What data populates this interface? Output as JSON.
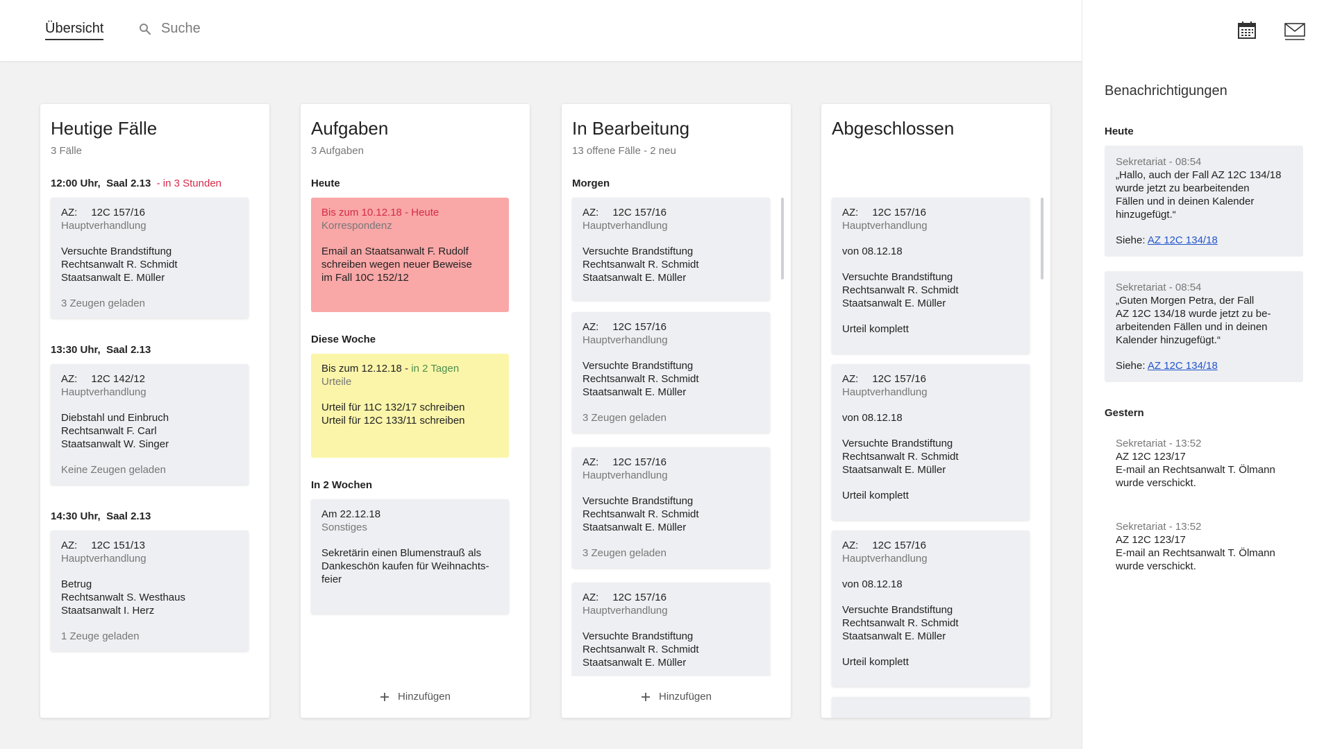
{
  "header": {
    "overview_label": "Übersicht",
    "search_placeholder": "Suche"
  },
  "icons": {
    "search": "search-icon",
    "calendar": "calendar-icon",
    "mail": "mail-icon",
    "add": "plus-icon"
  },
  "colors": {
    "alert_red": "#d42b4a",
    "task_red_bg": "#f9a7a7",
    "task_yellow_bg": "#fbf5aa",
    "due_green": "#4d8f4d",
    "link_blue": "#2255cc"
  },
  "columns": {
    "today": {
      "title": "Heutige Fälle",
      "subtitle": "3 Fälle",
      "slots": [
        {
          "time": "12:00 Uhr,",
          "room": "Saal 2.13",
          "note": "- in 3 Stunden",
          "card": {
            "az_label": "AZ:",
            "az": "12C 157/16",
            "type": "Hauptverhandlung",
            "desc": "Versuchte Brandstiftung\nRechtsanwalt R. Schmidt\nStaatsanwalt E. Müller",
            "extra": "3 Zeugen geladen"
          }
        },
        {
          "time": "13:30 Uhr,",
          "room": "Saal 2.13",
          "note": "",
          "card": {
            "az_label": "AZ:",
            "az": "12C 142/12",
            "type": "Hauptverhandlung",
            "desc": "Diebstahl und Einbruch\nRechtsanwalt F. Carl\nStaatsanwalt W. Singer",
            "extra": "Keine Zeugen geladen"
          }
        },
        {
          "time": "14:30 Uhr,",
          "room": "Saal 2.13",
          "note": "",
          "card": {
            "az_label": "AZ:",
            "az": "12C 151/13",
            "type": "Hauptverhandlung",
            "desc": "Betrug\nRechtsanwalt S. Westhaus\nStaatsanwalt I. Herz",
            "extra": "1 Zeuge geladen"
          }
        }
      ]
    },
    "tasks": {
      "title": "Aufgaben",
      "subtitle": "3 Aufgaben",
      "groups": [
        {
          "label": "Heute",
          "card": {
            "due": "Bis zum 10.12.18 -",
            "due_note": "Heute",
            "category": "Korrespondenz",
            "desc": "Email an Staatsanwalt F. Rudolf\nschreiben wegen neuer Beweise\nim Fall 10C 152/12"
          }
        },
        {
          "label": "Diese Woche",
          "card": {
            "due": "Bis zum 12.12.18 -",
            "due_note": "in 2 Tagen",
            "category": "Urteile",
            "desc": "Urteil für 11C 132/17 schreiben\nUrteil für 12C 133/11 schreiben"
          }
        },
        {
          "label": "In 2 Wochen",
          "card": {
            "due": "Am 22.12.18",
            "due_note": "",
            "category": "Sonstiges",
            "desc": "Sekretärin einen Blumenstrauß als\nDankeschön kaufen für Weihnachts-\nfeier"
          }
        }
      ],
      "add_label": "Hinzufügen"
    },
    "in_progress": {
      "title": "In Bearbeitung",
      "subtitle": "13 offene Fälle - 2 neu",
      "group_label": "Morgen",
      "cards": [
        {
          "az_label": "AZ:",
          "az": "12C 157/16",
          "type": "Hauptverhandlung",
          "desc": "Versuchte Brandstiftung\nRechtsanwalt R. Schmidt\nStaatsanwalt E. Müller",
          "extra": ""
        },
        {
          "az_label": "AZ:",
          "az": "12C 157/16",
          "type": "Hauptverhandlung",
          "desc": "Versuchte Brandstiftung\nRechtsanwalt R. Schmidt\nStaatsanwalt E. Müller",
          "extra": "3 Zeugen geladen"
        },
        {
          "az_label": "AZ:",
          "az": "12C 157/16",
          "type": "Hauptverhandlung",
          "desc": "Versuchte Brandstiftung\nRechtsanwalt R. Schmidt\nStaatsanwalt E. Müller",
          "extra": "3 Zeugen geladen"
        },
        {
          "az_label": "AZ:",
          "az": "12C 157/16",
          "type": "Hauptverhandlung",
          "desc": "Versuchte Brandstiftung\nRechtsanwalt R. Schmidt\nStaatsanwalt E. Müller",
          "extra": ""
        }
      ],
      "add_label": "Hinzufügen"
    },
    "done": {
      "title": "Abgeschlossen",
      "cards": [
        {
          "az_label": "AZ:",
          "az": "12C 157/16",
          "type": "Hauptverhandlung",
          "since": "von 08.12.18",
          "desc": "Versuchte Brandstiftung\nRechtsanwalt R. Schmidt\nStaatsanwalt E. Müller",
          "status": "Urteil komplett"
        },
        {
          "az_label": "AZ:",
          "az": "12C 157/16",
          "type": "Hauptverhandlung",
          "since": "von 08.12.18",
          "desc": "Versuchte Brandstiftung\nRechtsanwalt R. Schmidt\nStaatsanwalt E. Müller",
          "status": "Urteil komplett"
        },
        {
          "az_label": "AZ:",
          "az": "12C 157/16",
          "type": "Hauptverhandlung",
          "since": "von 08.12.18",
          "desc": "Versuchte Brandstiftung\nRechtsanwalt R. Schmidt\nStaatsanwalt E. Müller",
          "status": "Urteil komplett"
        }
      ]
    }
  },
  "notifications": {
    "title": "Benachrichtigungen",
    "today_label": "Heute",
    "yesterday_label": "Gestern",
    "see_label": "Siehe:",
    "today": [
      {
        "meta": "Sekretariat - 08:54",
        "body": "„Hallo, auch der Fall AZ 12C 134/18\nwurde jetzt zu bearbeitenden\nFällen und in deinen Kalender\nhinzugefügt.“",
        "link": "AZ 12C 134/18"
      },
      {
        "meta": "Sekretariat - 08:54",
        "body": "„Guten Morgen Petra, der Fall\nAZ 12C 134/18 wurde jetzt zu be-\narbeitenden Fällen und in deinen\nKalender hinzugefügt.“",
        "link": "AZ 12C 134/18"
      }
    ],
    "yesterday": [
      {
        "meta": "Sekretariat - 13:52",
        "body": "AZ 12C 123/17\nE-mail an Rechtsanwalt T. Ölmann\nwurde verschickt."
      },
      {
        "meta": "Sekretariat - 13:52",
        "body": "AZ 12C 123/17\nE-mail an Rechtsanwalt T. Ölmann\nwurde verschickt."
      }
    ]
  }
}
